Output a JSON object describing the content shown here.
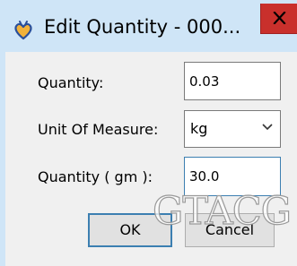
{
  "window": {
    "title": "Edit Quantity - 000...",
    "close_icon": "close-x-icon",
    "app_icon": "heart-app-icon"
  },
  "form": {
    "quantity": {
      "label": "Quantity:",
      "value": "0.03"
    },
    "unit": {
      "label": "Unit Of Measure:",
      "value": "kg"
    },
    "quantity_gm": {
      "label": "Quantity ( gm ):",
      "value": "30.0"
    }
  },
  "buttons": {
    "ok": "OK",
    "cancel": "Cancel"
  },
  "watermark": "GTACG",
  "colors": {
    "title_bar": "#cfe5f7",
    "close_button": "#c9302c",
    "dialog_bg": "#f0f0f0",
    "focus_border": "#3c7fb1"
  }
}
